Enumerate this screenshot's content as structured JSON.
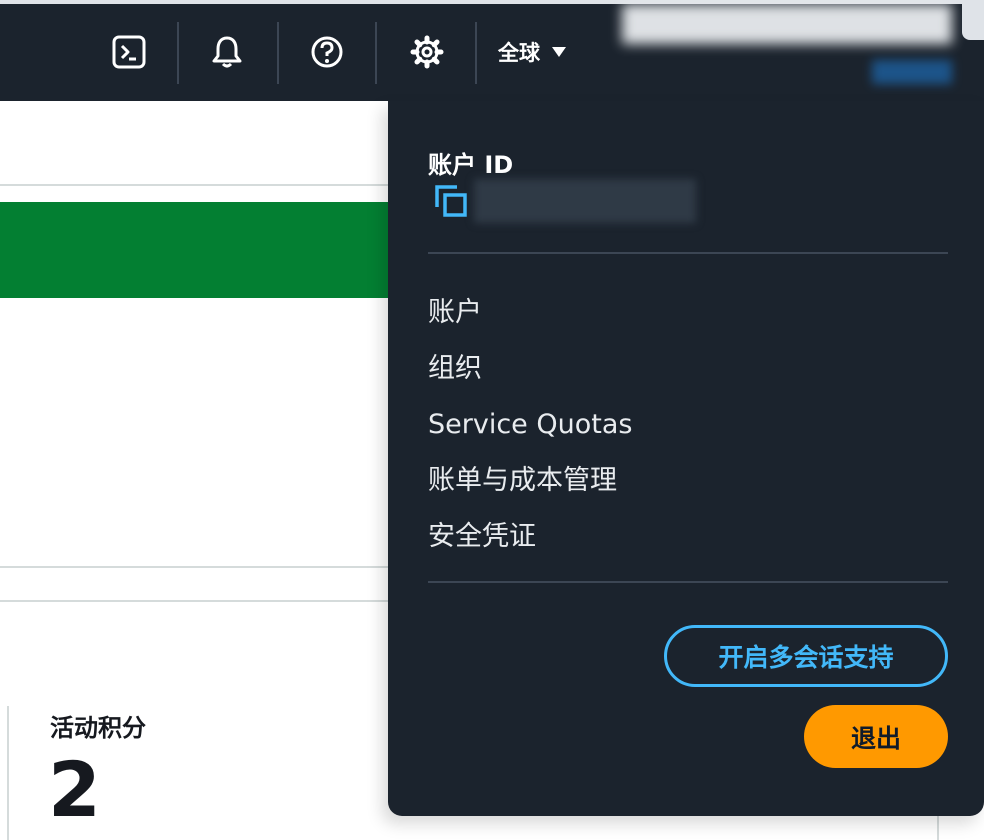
{
  "topnav": {
    "icons": {
      "cloudshell": "terminal-icon",
      "notifications": "bell-icon",
      "help": "question-circle-icon",
      "settings": "gear-icon"
    },
    "region_label": "全球"
  },
  "background_page": {
    "metric_label": "活动积分",
    "metric_value": "2"
  },
  "account_menu": {
    "account_id_label": "账户 ID",
    "items": [
      {
        "label": "账户"
      },
      {
        "label": "组织"
      },
      {
        "label": "Service Quotas"
      },
      {
        "label": "账单与成本管理"
      },
      {
        "label": "安全凭证"
      }
    ],
    "multi_session_button": "开启多会话支持",
    "sign_out_button": "退出"
  },
  "colors": {
    "nav_background": "#1b232d",
    "accent_blue": "#42b8f9",
    "sign_out_orange": "#ff9900",
    "success_green": "#037f32"
  }
}
